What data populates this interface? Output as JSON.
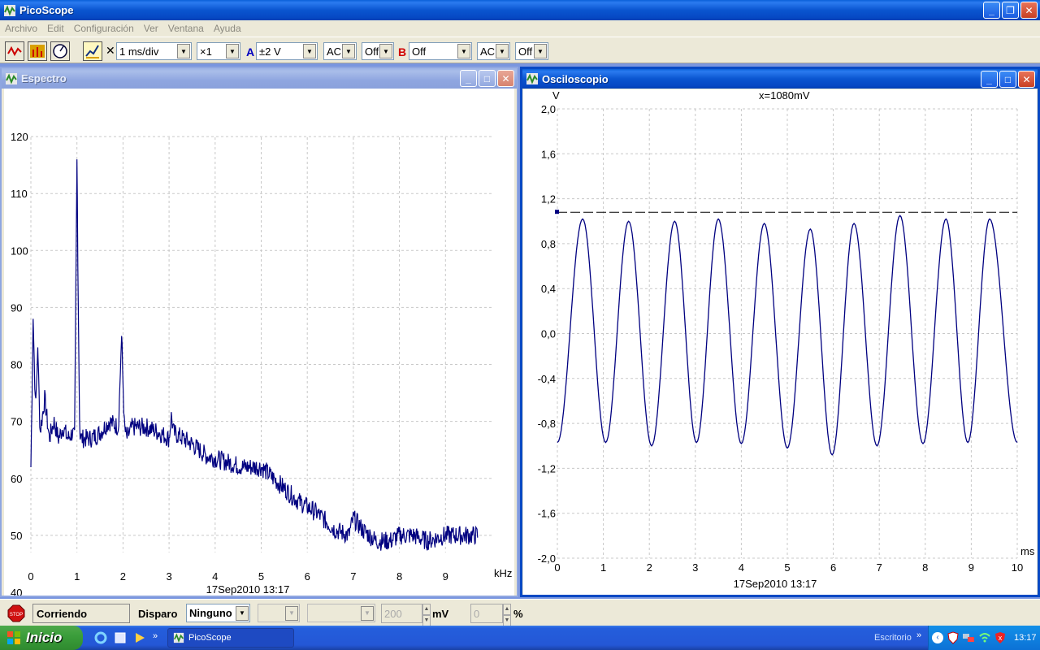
{
  "app": {
    "title": "PicoScope"
  },
  "menu": [
    "Archivo",
    "Edit",
    "Configuración",
    "Ver",
    "Ventana",
    "Ayuda"
  ],
  "toolbar": {
    "timebase": "1 ms/div",
    "multiplier": "×1",
    "channel_a_label": "A",
    "channel_a_range": "±2 V",
    "channel_a_coupling": "AC",
    "channel_a_extra": "Off",
    "channel_b_label": "B",
    "channel_b_range": "Off",
    "channel_b_coupling": "AC",
    "channel_b_extra": "Off",
    "close_mark": "✕"
  },
  "spectrum": {
    "title": "Espectro",
    "timestamp": "17Sep2010  13:17",
    "x_unit": "kHz",
    "chart_data": {
      "type": "line",
      "x_ticks": [
        "0",
        "1",
        "2",
        "3",
        "4",
        "5",
        "6",
        "7",
        "8",
        "9"
      ],
      "y_ticks": [
        "120",
        "110",
        "100",
        "90",
        "80",
        "70",
        "60",
        "50",
        "40"
      ],
      "xlim": [
        0,
        10
      ],
      "ylim": [
        40,
        127
      ],
      "series": [
        {
          "x": [
            0,
            0.05,
            0.1,
            0.15,
            0.2,
            0.3,
            0.4,
            0.5,
            0.6,
            0.7,
            0.8,
            0.9,
            0.95,
            1.0,
            1.03,
            1.06,
            1.1,
            1.3,
            1.5,
            1.7,
            1.9,
            1.97,
            2.03,
            2.08,
            2.2,
            2.5,
            2.8,
            3.0,
            3.05,
            3.1,
            3.3,
            3.5,
            3.8,
            4.2,
            4.6,
            5.0,
            5.4,
            5.8,
            6.2,
            6.6,
            6.9,
            7.0,
            7.2,
            7.5,
            7.8,
            8.0,
            8.3,
            8.6,
            9.0,
            9.3,
            9.7
          ],
          "y": [
            62,
            88,
            72,
            83,
            68,
            74,
            67,
            70,
            67,
            69,
            67,
            68,
            67,
            116,
            90,
            68,
            67,
            67,
            68,
            70,
            69,
            85,
            69,
            67,
            69,
            69,
            68,
            67,
            71,
            68,
            67,
            66,
            64,
            63,
            62,
            62,
            59,
            56,
            54,
            51,
            50,
            53,
            51,
            49,
            49,
            50,
            50,
            49,
            50,
            50,
            50
          ]
        }
      ]
    }
  },
  "scope": {
    "title": "Osciloscopio",
    "y_unit": "V",
    "x_unit": "ms",
    "readout": "x=1080mV",
    "timestamp": "17Sep2010  13:17",
    "chart_data": {
      "type": "line",
      "x_ticks": [
        "0",
        "1",
        "2",
        "3",
        "4",
        "5",
        "6",
        "7",
        "8",
        "9",
        "10"
      ],
      "y_ticks": [
        "2,0",
        "1,6",
        "1,2",
        "0,8",
        "0,4",
        "0,0",
        "-0,4",
        "-0,8",
        "-1,2",
        "-1,6",
        "-2,0"
      ],
      "xlim": [
        0,
        10
      ],
      "ylim": [
        -2.0,
        2.0
      ],
      "threshold": 1.08,
      "series": [
        {
          "name": "A",
          "frequency_khz": 1.0,
          "peaks_x": [
            0.55,
            1.55,
            2.55,
            3.5,
            4.5,
            5.5,
            6.45,
            7.45,
            8.45,
            9.4
          ],
          "peaks_y": [
            1.02,
            1.0,
            1.0,
            1.02,
            0.98,
            0.93,
            0.98,
            1.05,
            1.02,
            1.02
          ],
          "troughs_y": [
            -0.97,
            -0.97,
            -1.0,
            -0.97,
            -0.98,
            -1.02,
            -1.08,
            -1.0,
            -0.98,
            -0.97,
            -0.97
          ]
        }
      ]
    }
  },
  "status": {
    "state": "Corriendo",
    "trigger_label": "Disparo",
    "trigger_mode": "Ninguno",
    "level_value": "200",
    "level_unit": "mV",
    "pct_value": "0",
    "pct_unit": "%"
  },
  "taskbar": {
    "start": "Inicio",
    "task": "PicoScope",
    "desktop": "Escritorio",
    "clock": "13:17"
  }
}
